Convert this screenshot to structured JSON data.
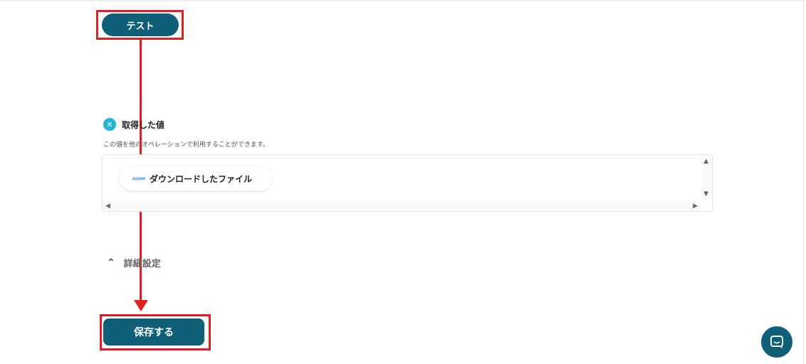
{
  "toolbar": {
    "test_label": "テスト"
  },
  "result": {
    "title": "取得した値",
    "description": "この値を他のオペレーションで利用することができます。",
    "chip": {
      "logo": "zoom",
      "label": "ダウンロードしたファイル"
    }
  },
  "advanced": {
    "label": "詳細設定"
  },
  "footer": {
    "save_label": "保存する"
  },
  "colors": {
    "primary": "#0f5f78",
    "highlight": "#e02020",
    "badge": "#22b5d6"
  },
  "icons": {
    "badge": "x-badge-icon",
    "chevron": "chevron-up-icon",
    "chat": "chat-icon"
  }
}
